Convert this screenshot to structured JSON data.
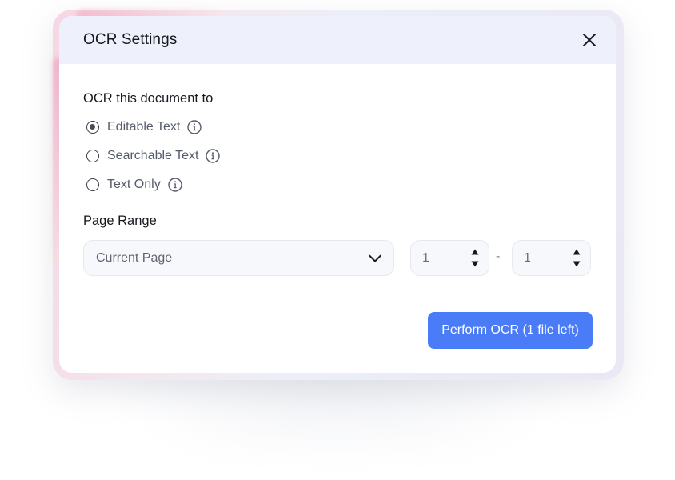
{
  "dialog": {
    "title": "OCR Settings",
    "close_icon": "close-icon"
  },
  "ocr_mode": {
    "label": "OCR this document to",
    "options": [
      {
        "label": "Editable Text",
        "checked": true,
        "icon": "info-icon"
      },
      {
        "label": "Searchable Text",
        "checked": false,
        "icon": "info-icon"
      },
      {
        "label": "Text Only",
        "checked": false,
        "icon": "info-icon"
      }
    ]
  },
  "page_range": {
    "label": "Page Range",
    "selected": "Current Page",
    "dropdown_icon": "chevron-down-icon",
    "from": "1",
    "separator": "-",
    "to": "1"
  },
  "actions": {
    "perform_label": "Perform OCR (1 file left)"
  },
  "colors": {
    "accent": "#4a7cf7",
    "header_bg": "#eef1fb"
  }
}
